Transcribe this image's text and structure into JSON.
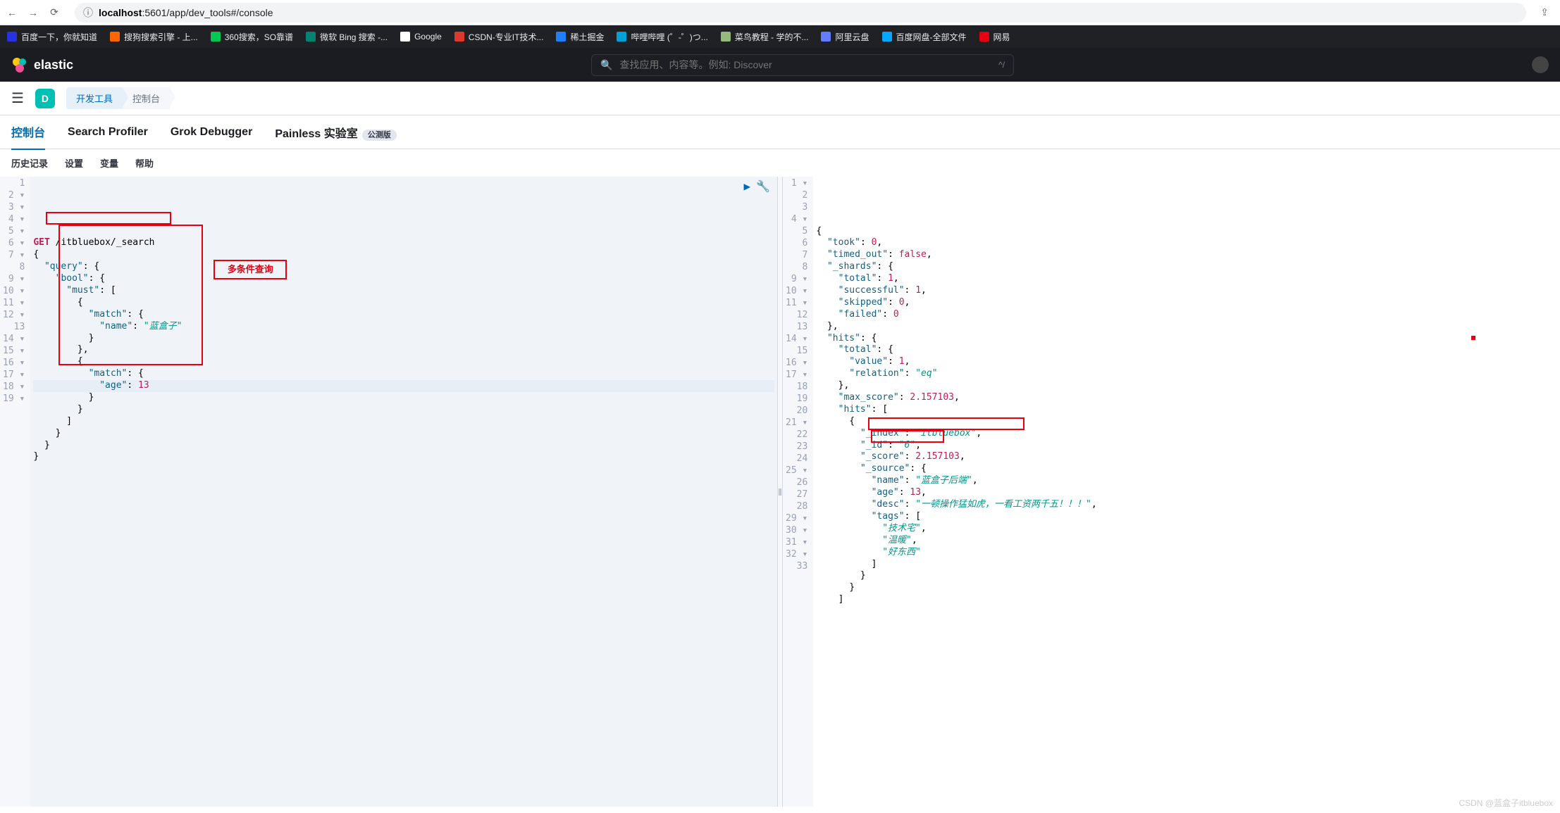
{
  "browser": {
    "url_prefix": "localhost",
    "url_suffix": ":5601/app/dev_tools#/console"
  },
  "bookmarks": [
    {
      "label": "百度一下，你就知道"
    },
    {
      "label": "搜狗搜索引擎 - 上..."
    },
    {
      "label": "360搜索，SO靠谱"
    },
    {
      "label": "微软 Bing 搜索 -..."
    },
    {
      "label": "Google"
    },
    {
      "label": "CSDN-专业IT技术..."
    },
    {
      "label": "稀土掘金"
    },
    {
      "label": "哔哩哔哩 (゜-゜)つ..."
    },
    {
      "label": "菜鸟教程 - 学的不..."
    },
    {
      "label": "阿里云盘"
    },
    {
      "label": "百度网盘-全部文件"
    },
    {
      "label": "网易"
    }
  ],
  "es": {
    "brand": "elastic",
    "search_placeholder": "查找应用、内容等。例如: Discover",
    "kbd": "^/"
  },
  "app": {
    "badge": "D",
    "crumb1": "开发工具",
    "crumb2": "控制台"
  },
  "tabs": {
    "console": "控制台",
    "profiler": "Search Profiler",
    "grok": "Grok Debugger",
    "painless": "Painless 实验室",
    "beta": "公测版"
  },
  "submenu": {
    "history": "历史记录",
    "settings": "设置",
    "variables": "变量",
    "help": "帮助"
  },
  "annotation": {
    "multi_query": "多条件查询"
  },
  "request": {
    "method": "GET",
    "path": "/itbluebox/_search",
    "body_keys": {
      "query": "query",
      "bool": "bool",
      "must": "must",
      "match": "match",
      "name": "name",
      "age": "age"
    },
    "body_values": {
      "name": "蓝盒子",
      "age": 13
    }
  },
  "response": {
    "took": 0,
    "timed_out": false,
    "shards": {
      "total": 1,
      "successful": 1,
      "skipped": 0,
      "failed": 0
    },
    "hits": {
      "total": {
        "value": 1,
        "relation": "eq"
      },
      "max_score": 2.157103,
      "hit": {
        "_index": "itbluebox",
        "_id": "6",
        "_score": 2.157103,
        "_source": {
          "name": "蓝盒子后端",
          "age": 13,
          "desc": "一顿操作猛如虎，一看工资两千五！！！",
          "tags": [
            "技术宅",
            "温暖",
            "好东西"
          ]
        }
      }
    }
  },
  "left_line_numbers": [
    "1",
    "2 ▾",
    "3 ▾",
    "4 ▾",
    "5 ▾",
    "6 ▾",
    "7 ▾",
    "8",
    "9 ▾",
    "10 ▾",
    "11 ▾",
    "12 ▾",
    "13",
    "14 ▾",
    "15 ▾",
    "16 ▾",
    "17 ▾",
    "18 ▾",
    "19 ▾"
  ],
  "right_line_numbers": [
    "1 ▾",
    "2",
    "3",
    "4 ▾",
    "5",
    "6",
    "7",
    "8",
    "9 ▾",
    "10 ▾",
    "11 ▾",
    "12",
    "13",
    "14 ▾",
    "15",
    "16 ▾",
    "17 ▾",
    "18",
    "19",
    "20",
    "21 ▾",
    "22",
    "23",
    "24",
    "25 ▾",
    "26",
    "27",
    "28",
    "29 ▾",
    "30 ▾",
    "31 ▾",
    "32 ▾",
    "33"
  ],
  "watermark": "CSDN @蓝盒子itbluebox"
}
